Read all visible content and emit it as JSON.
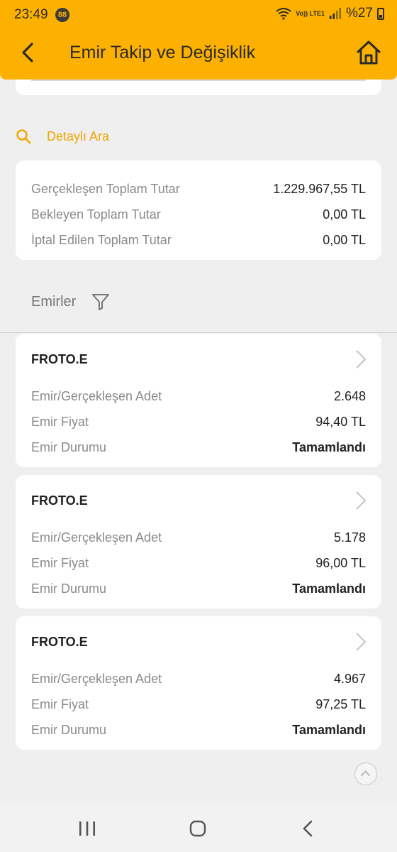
{
  "status_bar": {
    "time": "23:49",
    "notification_count": "88",
    "network": "Vo)) LTE1",
    "battery": "%27"
  },
  "header": {
    "title": "Emir Takip ve Değişiklik"
  },
  "detail_search": {
    "label": "Detaylı Ara"
  },
  "totals": [
    {
      "label": "Gerçekleşen Toplam Tutar",
      "value": "1.229.967,55 TL"
    },
    {
      "label": "Bekleyen Toplam Tutar",
      "value": "0,00 TL"
    },
    {
      "label": "İptal Edilen Toplam Tutar",
      "value": "0,00 TL"
    }
  ],
  "orders_section": {
    "label": "Emirler"
  },
  "orders": [
    {
      "symbol": "FROTO.E",
      "qty_label": "Emir/Gerçekleşen Adet",
      "qty": "2.648",
      "price_label": "Emir Fiyat",
      "price": "94,40 TL",
      "status_label": "Emir Durumu",
      "status": "Tamamlandı"
    },
    {
      "symbol": "FROTO.E",
      "qty_label": "Emir/Gerçekleşen Adet",
      "qty": "5.178",
      "price_label": "Emir Fiyat",
      "price": "96,00 TL",
      "status_label": "Emir Durumu",
      "status": "Tamamlandı"
    },
    {
      "symbol": "FROTO.E",
      "qty_label": "Emir/Gerçekleşen Adet",
      "qty": "4.967",
      "price_label": "Emir Fiyat",
      "price": "97,25 TL",
      "status_label": "Emir Durumu",
      "status": "Tamamlandı"
    }
  ],
  "colors": {
    "accent": "#fcb100",
    "link": "#f0a500",
    "background": "#efefef",
    "card": "#ffffff"
  },
  "icons": [
    "back-arrow-icon",
    "home-icon",
    "search-icon",
    "filter-icon",
    "chevron-right-icon",
    "chevron-up-icon",
    "wifi-icon",
    "signal-icon",
    "battery-icon",
    "recents-icon",
    "home-circle-icon",
    "back-icon"
  ]
}
